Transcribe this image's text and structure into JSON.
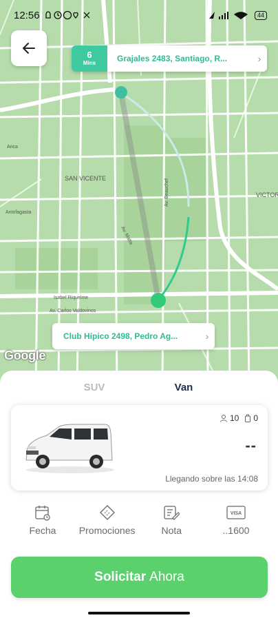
{
  "status_bar": {
    "time": "12:56",
    "battery": "44"
  },
  "map": {
    "labels": {
      "san_vicente": "SAN VICENTE",
      "victoria": "VICTOR",
      "antofagasta": "Antofagasta",
      "arica": "Arica",
      "av_beauchef": "Av. Beauchef",
      "av_matta": "Av. Matta",
      "isabel_riquelme": "Isabel Riquelme",
      "carlos_valdovinos": "Av. Carlos Valdovinos"
    },
    "google_logo": "Google"
  },
  "destination": {
    "eta_value": "6",
    "eta_unit": "Mins",
    "address": "Grajales 2483, Santiago, R..."
  },
  "origin": {
    "address": "Club Hípico 2498, Pedro Ag..."
  },
  "tabs": [
    {
      "label": "SUV",
      "active": false
    },
    {
      "label": "Van",
      "active": true
    }
  ],
  "vehicle": {
    "passengers": "10",
    "luggage": "0",
    "price": "--",
    "arrival": "Llegando sobre las 14:08"
  },
  "options": [
    {
      "label": "Fecha",
      "icon": "calendar-icon"
    },
    {
      "label": "Promociones",
      "icon": "promo-ticket-icon"
    },
    {
      "label": "Nota",
      "icon": "note-icon"
    },
    {
      "label": "..1600",
      "icon": "visa-card-icon"
    }
  ],
  "cta": {
    "bold": "Solicitar",
    "regular": "Ahora"
  },
  "colors": {
    "accent": "#3ec9a0",
    "cta": "#5bd16d",
    "map_green": "#b6dcab"
  }
}
